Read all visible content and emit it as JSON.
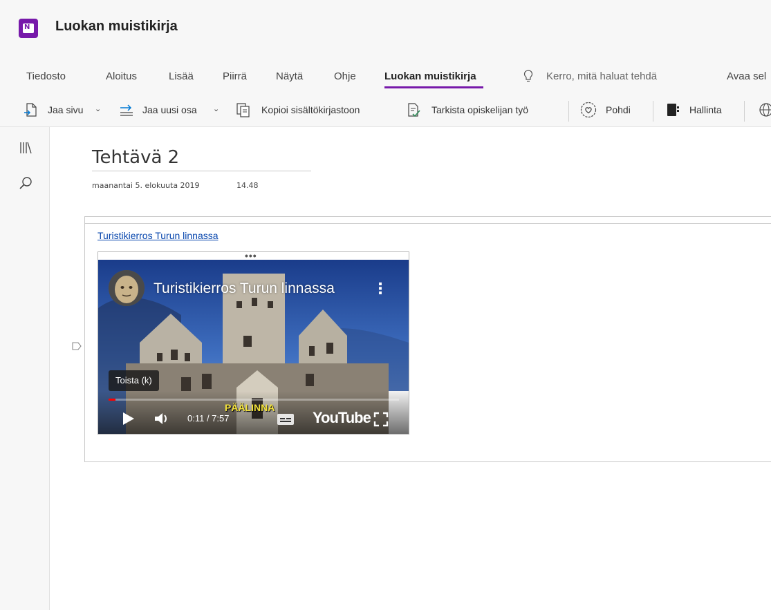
{
  "app": {
    "title": "Luokan muistikirja",
    "logo_letter": "N",
    "accent": "#7719aa"
  },
  "menu": {
    "items": [
      {
        "label": "Tiedosto"
      },
      {
        "label": "Aloitus"
      },
      {
        "label": "Lisää"
      },
      {
        "label": "Piirrä"
      },
      {
        "label": "Näytä"
      },
      {
        "label": "Ohje"
      },
      {
        "label": "Luokan muistikirja",
        "active": true
      }
    ],
    "tell_me": "Kerro, mitä haluat tehdä",
    "open_label": "Avaa sel"
  },
  "toolbar": {
    "share_page": "Jaa sivu",
    "share_section": "Jaa uusi osa",
    "copy_library": "Kopioi sisältökirjastoon",
    "review_work": "Tarkista opiskelijan työ",
    "reflect": "Pohdi",
    "manage": "Hallinta"
  },
  "page": {
    "title": "Tehtävä 2",
    "date": "maanantai 5. elokuuta 2019",
    "time": "14.48"
  },
  "video": {
    "link_text": "Turistikierros Turun linnassa",
    "title": "Turistikierros Turun linnassa",
    "tooltip": "Toista (k)",
    "time": "0:11 / 7:57",
    "caption": "PÄÄLINNA",
    "brand": "YouTube",
    "progress": 0.023,
    "progress_color": "#ff0000"
  },
  "icons": {
    "rail": [
      "library-icon",
      "search-icon"
    ],
    "toolbar": [
      "share-page-icon",
      "share-section-icon",
      "copy-library-icon",
      "review-work-icon",
      "reflect-icon",
      "manage-icon"
    ]
  }
}
